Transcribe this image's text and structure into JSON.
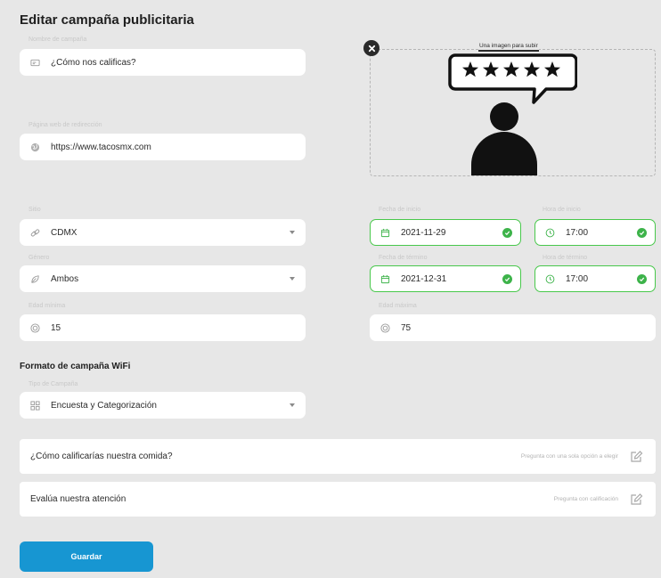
{
  "page": {
    "title": "Editar campaña publicitaria"
  },
  "campaign_name": {
    "label": "Nombre de campaña",
    "value": "¿Cómo nos calificas?"
  },
  "redirect": {
    "label": "Página web de redirección",
    "value": "https://www.tacosmx.com"
  },
  "image_upload": {
    "caption": "Una imagen para subir"
  },
  "site": {
    "label": "Sitio",
    "value": "CDMX"
  },
  "gender": {
    "label": "Género",
    "value": "Ambos"
  },
  "min_age": {
    "label": "Edad mínima",
    "value": "15"
  },
  "max_age": {
    "label": "Edad máxima",
    "value": "75"
  },
  "start_date": {
    "label": "Fecha de inicio",
    "value": "2021-11-29"
  },
  "start_time": {
    "label": "Hora de inicio",
    "value": "17:00"
  },
  "end_date": {
    "label": "Fecha de término",
    "value": "2021-12-31"
  },
  "end_time": {
    "label": "Hora de término",
    "value": "17:00"
  },
  "wifi_format": {
    "title": "Formato de campaña WiFi",
    "type_label": "Tipo de Campaña",
    "type_value": "Encuesta y Categorización"
  },
  "questions": [
    {
      "text": "¿Cómo calificarías nuestra comida?",
      "type": "Pregunta con una sola opción a elegir"
    },
    {
      "text": "Evalúa nuestra atención",
      "type": "Pregunta con calificación"
    }
  ],
  "save_button": {
    "label": "Guardar"
  },
  "colors": {
    "primary": "#1796d2",
    "success": "#3db34a",
    "background": "#e7e7e7"
  }
}
